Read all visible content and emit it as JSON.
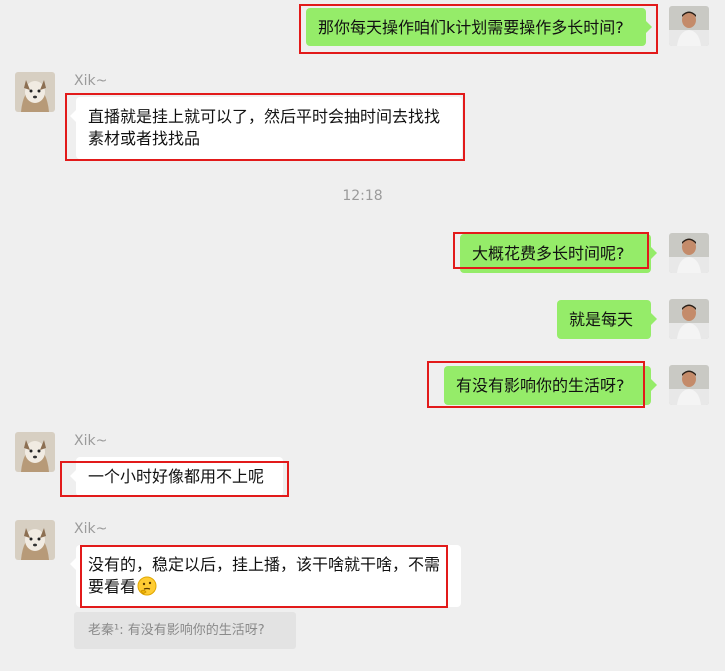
{
  "contact": {
    "name": "Xik~"
  },
  "messages": [
    {
      "from": "me",
      "text": "那你每天操作咱们k计划需要操作多长时间?"
    },
    {
      "from": "contact",
      "sender": "Xik~",
      "text": "直播就是挂上就可以了，然后平时会抽时间去找找素材或者找找品"
    },
    {
      "from": "me",
      "text": "大概花费多长时间呢?"
    },
    {
      "from": "me",
      "text": "就是每天"
    },
    {
      "from": "me",
      "text": "有没有影响你的生活呀?"
    },
    {
      "from": "contact",
      "sender": "Xik~",
      "text": "一个小时好像都用不上呢"
    },
    {
      "from": "contact",
      "sender": "Xik~",
      "text": "没有的，稳定以后，挂上播，该干啥就干啥，不需要看看",
      "emoji": "thinking-face"
    }
  ],
  "timestamp": "12:18",
  "quote": {
    "text": "老秦¹: 有没有影响你的生活呀?"
  },
  "colors": {
    "mine_bubble": "#95ec69",
    "their_bubble": "#ffffff",
    "background": "#efefef",
    "highlight": "#e21a1a"
  }
}
